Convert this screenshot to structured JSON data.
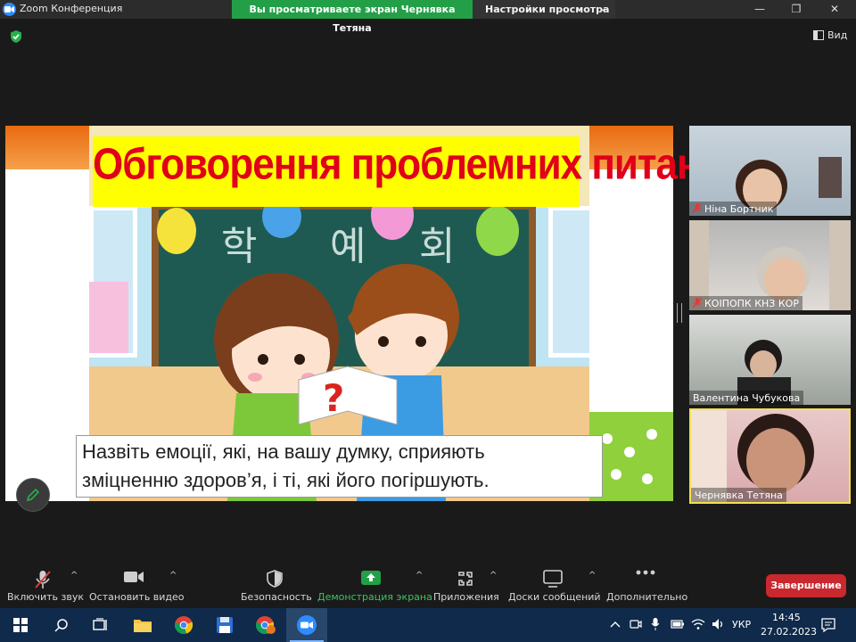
{
  "window": {
    "app_title": "Zoom Конференция",
    "share_banner": "Вы просматриваете экран Чернявка Тетяна",
    "view_settings": "Настройки просмотра",
    "view_label": "Вид"
  },
  "slide": {
    "title": "Обговорення проблемних питань",
    "question": "Назвіть емоції, які, на вашу думку, сприяють\nзміцненню здоров’я, і ті, які його погіршують."
  },
  "participants": [
    {
      "name": "Ніна Бортник",
      "muted": true
    },
    {
      "name": "КОІПОПК КНЗ КОР",
      "muted": true
    },
    {
      "name": "Валентина Чубукова",
      "muted": false
    },
    {
      "name": "Чернявка Тетяна",
      "muted": false,
      "active_speaker": true
    }
  ],
  "toolbar": {
    "mute": "Включить звук",
    "video": "Остановить видео",
    "security": "Безопасность",
    "share": "Демонстрация экрана",
    "apps": "Приложения",
    "whiteboards": "Доски сообщений",
    "more": "Дополнительно",
    "end": "Завершение"
  },
  "taskbar": {
    "language": "УКР",
    "time": "14:45",
    "date": "27.02.2023"
  },
  "colors": {
    "share_green": "#23a047",
    "end_red": "#c8282e",
    "title_red": "#e0001a",
    "title_yellow": "#ffff00",
    "active_border": "#f4e04d"
  }
}
